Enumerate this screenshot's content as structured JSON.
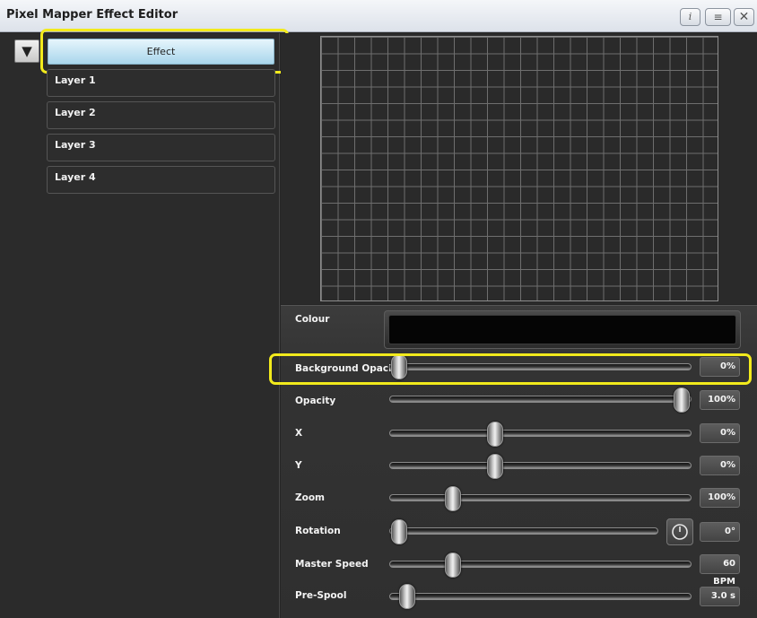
{
  "window": {
    "title": "Pixel Mapper Effect Editor",
    "info_label": "i",
    "menu_label": "≡",
    "close_label": "✕"
  },
  "left_panel": {
    "collapse_icon": "▼",
    "effect_label": "Effect",
    "layers": [
      {
        "label": "Layer 1"
      },
      {
        "label": "Layer 2"
      },
      {
        "label": "Layer 3"
      },
      {
        "label": "Layer 4"
      }
    ]
  },
  "properties": {
    "colour_label": "Colour",
    "colour_value": "#050505",
    "sliders": [
      {
        "label": "Background Opacity",
        "value": "0%",
        "level": 0.0
      },
      {
        "label": "Opacity",
        "value": "100%",
        "level": 1.0
      },
      {
        "label": "X",
        "value": "0%",
        "level": 0.34
      },
      {
        "label": "Y",
        "value": "0%",
        "level": 0.34
      },
      {
        "label": "Zoom",
        "value": "100%",
        "level": 0.19
      },
      {
        "label": "Rotation",
        "value": "0°",
        "level": 0.0
      },
      {
        "label": "Master Speed",
        "value": "60 BPM",
        "level": 0.19
      },
      {
        "label": "Pre-Spool",
        "value": "3.0 s",
        "level": 0.03
      }
    ]
  },
  "icons": {
    "rotation_button": "clock-icon",
    "collapse": "triangle-down-icon"
  },
  "colors": {
    "highlight": "#f2ea1c",
    "effect_button": "#bfe3f4",
    "panel_bg": "#2b2b2b"
  }
}
